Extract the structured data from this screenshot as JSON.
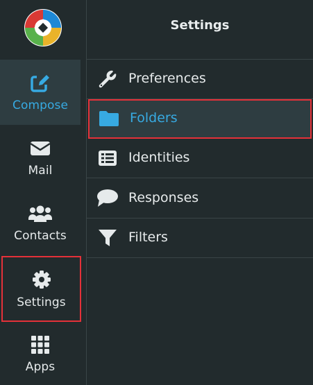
{
  "nav": {
    "items": [
      {
        "label": "Compose",
        "icon": "compose-icon",
        "active": true
      },
      {
        "label": "Mail",
        "icon": "mail-icon"
      },
      {
        "label": "Contacts",
        "icon": "contacts-icon"
      },
      {
        "label": "Settings",
        "icon": "gear-icon",
        "highlighted": true
      },
      {
        "label": "Apps",
        "icon": "apps-grid-icon"
      }
    ]
  },
  "panel": {
    "title": "Settings",
    "items": [
      {
        "label": "Preferences",
        "icon": "wrench-icon"
      },
      {
        "label": "Folders",
        "icon": "folder-icon",
        "selected": true
      },
      {
        "label": "Identities",
        "icon": "identities-list-icon"
      },
      {
        "label": "Responses",
        "icon": "speech-bubble-icon"
      },
      {
        "label": "Filters",
        "icon": "filter-funnel-icon"
      }
    ]
  },
  "colors": {
    "background": "#222b2d",
    "accent": "#37aae2",
    "selected_bg": "#2e3d41",
    "highlight_border": "#e53139",
    "text": "#e6eaeb",
    "separator": "#3a4547"
  }
}
